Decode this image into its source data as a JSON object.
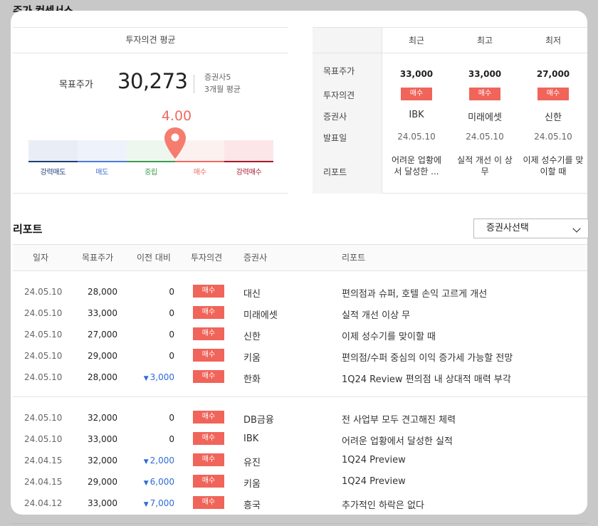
{
  "page_title": "주가 컨센서스",
  "summary": {
    "header": "투자의견 평균",
    "target_label": "목표주가",
    "target_value": "30,273",
    "brokers_count": "증권사5",
    "period": "3개월 평균",
    "score": "4.00",
    "score_fraction": 0.6,
    "scale": [
      {
        "label": "강력매도",
        "bg": "#e9eef6",
        "bar": "#1d3f73",
        "text": "#1d3f73"
      },
      {
        "label": "매도",
        "bg": "#eef3fb",
        "bar": "#4b7be0",
        "text": "#3d6fd6"
      },
      {
        "label": "중립",
        "bg": "#eef7ee",
        "bar": "#3c9a4d",
        "text": "#3c9a4d"
      },
      {
        "label": "매수",
        "bg": "#fdf1f0",
        "bar": "#f06a5f",
        "text": "#f06a5f"
      },
      {
        "label": "강력매수",
        "bg": "#fce6e8",
        "bar": "#a8182b",
        "text": "#a8182b"
      }
    ],
    "pin_color": "#f57c6e"
  },
  "compare": {
    "columns": [
      "최근",
      "최고",
      "최저"
    ],
    "row_labels": [
      "목표주가",
      "투자의견",
      "증권사",
      "발표일",
      "리포트"
    ],
    "cells": [
      {
        "target": "33,000",
        "opinion": "매수",
        "broker": "IBK",
        "date": "24.05.10",
        "report": "어려운 업황에 서 달성한 ..."
      },
      {
        "target": "33,000",
        "opinion": "매수",
        "broker": "미래에셋",
        "date": "24.05.10",
        "report": "실적 개선 이 상 무"
      },
      {
        "target": "27,000",
        "opinion": "매수",
        "broker": "신한",
        "date": "24.05.10",
        "report": "이제 성수기를 맞이할 때"
      }
    ]
  },
  "reports": {
    "title": "리포트",
    "select_label": "증권사선택",
    "headers": [
      "일자",
      "목표주가",
      "이전 대비",
      "투자의견",
      "증권사",
      "리포트"
    ],
    "rows": [
      {
        "date": "24.05.10",
        "price": "28,000",
        "diff": "0",
        "down": false,
        "opinion": "매수",
        "broker": "대신",
        "report": "편의점과 슈퍼, 호텔 손익 고르게 개선"
      },
      {
        "date": "24.05.10",
        "price": "33,000",
        "diff": "0",
        "down": false,
        "opinion": "매수",
        "broker": "미래에셋",
        "report": "실적 개선 이상 무"
      },
      {
        "date": "24.05.10",
        "price": "27,000",
        "diff": "0",
        "down": false,
        "opinion": "매수",
        "broker": "신한",
        "report": "이제 성수기를 맞이할 때"
      },
      {
        "date": "24.05.10",
        "price": "29,000",
        "diff": "0",
        "down": false,
        "opinion": "매수",
        "broker": "키움",
        "report": "편의점/수퍼 중심의 이익 증가세 가능할 전망"
      },
      {
        "date": "24.05.10",
        "price": "28,000",
        "diff": "3,000",
        "down": true,
        "opinion": "매수",
        "broker": "한화",
        "report": "1Q24 Review 편의점 내 상대적 매력 부각"
      },
      {
        "date": "24.05.10",
        "price": "32,000",
        "diff": "0",
        "down": false,
        "opinion": "매수",
        "broker": "DB금융",
        "report": "전 사업부 모두 견고해진 체력"
      },
      {
        "date": "24.05.10",
        "price": "33,000",
        "diff": "0",
        "down": false,
        "opinion": "매수",
        "broker": "IBK",
        "report": "어려운 업황에서 달성한 실적"
      },
      {
        "date": "24.04.15",
        "price": "32,000",
        "diff": "2,000",
        "down": true,
        "opinion": "매수",
        "broker": "유진",
        "report": "1Q24 Preview"
      },
      {
        "date": "24.04.15",
        "price": "29,000",
        "diff": "6,000",
        "down": true,
        "opinion": "매수",
        "broker": "키움",
        "report": "1Q24 Preview"
      },
      {
        "date": "24.04.12",
        "price": "33,000",
        "diff": "7,000",
        "down": true,
        "opinion": "매수",
        "broker": "흥국",
        "report": "추가적인 하락은 없다"
      }
    ]
  },
  "colors": {
    "buy_badge": "#f0645a",
    "down_arrow": "#2f6bd8"
  }
}
